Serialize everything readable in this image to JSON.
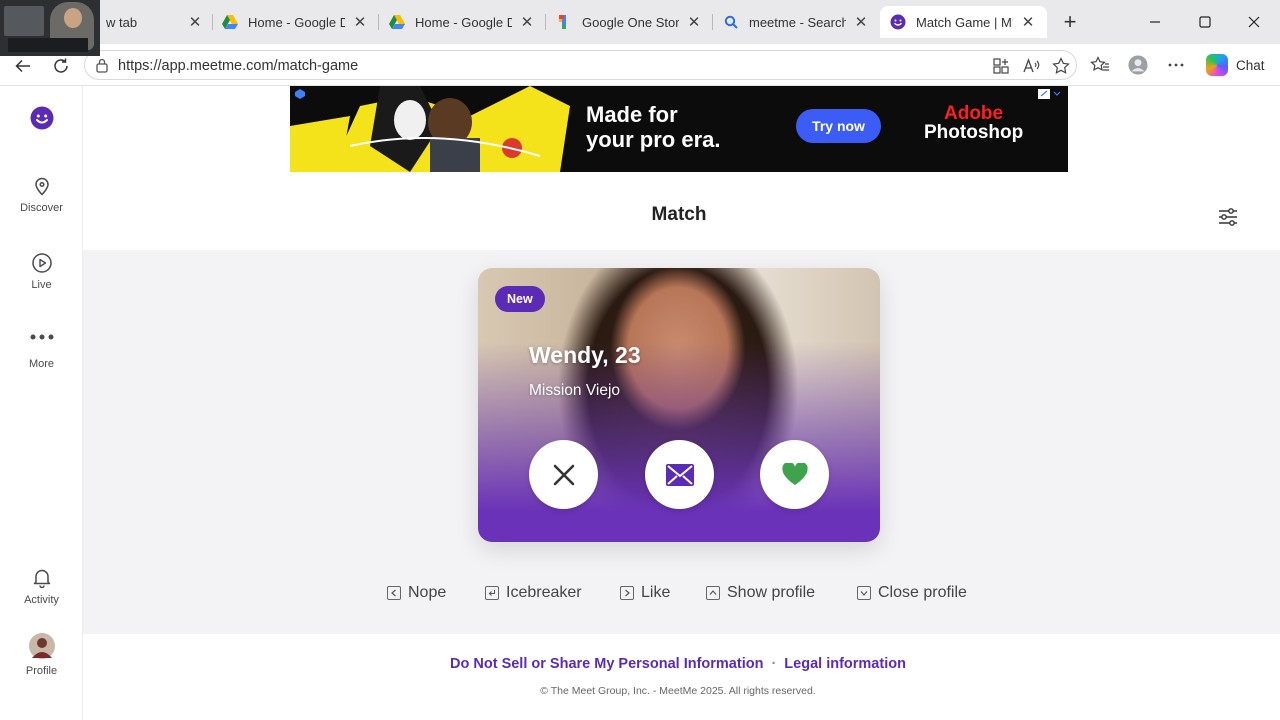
{
  "browser": {
    "tabs": [
      {
        "title": "w tab",
        "icon": "new-tab-icon"
      },
      {
        "title": "Home - Google Dr",
        "icon": "google-drive-icon"
      },
      {
        "title": "Home - Google Dr",
        "icon": "google-drive-icon"
      },
      {
        "title": "Google One Storag",
        "icon": "google-one-icon"
      },
      {
        "title": "meetme - Search",
        "icon": "search-icon"
      },
      {
        "title": "Match Game | ME",
        "icon": "meetme-icon",
        "active": true
      }
    ],
    "url": "https://app.meetme.com/match-game",
    "chat_label": "Chat"
  },
  "sidebar": {
    "items": [
      {
        "label": "Discover",
        "icon": "location-pin-icon"
      },
      {
        "label": "Live",
        "icon": "play-circle-icon"
      },
      {
        "label": "More",
        "icon": "more-dots-icon"
      },
      {
        "label": "Activity",
        "icon": "bell-icon"
      },
      {
        "label": "Profile",
        "icon": "avatar"
      }
    ]
  },
  "ad": {
    "headline_line1": "Made for",
    "headline_line2": "your pro era.",
    "cta": "Try now",
    "brand_line1": "Adobe",
    "brand_line2": "Photoshop"
  },
  "match": {
    "title": "Match",
    "card": {
      "badge": "New",
      "name": "Wendy, 23",
      "location": "Mission Viejo"
    },
    "shortcuts": [
      {
        "label": "Nope"
      },
      {
        "label": "Icebreaker"
      },
      {
        "label": "Like"
      },
      {
        "label": "Show profile"
      },
      {
        "label": "Close profile"
      }
    ]
  },
  "footer": {
    "link1": "Do Not Sell or Share My Personal Information",
    "separator": "·",
    "link2": "Legal information",
    "copyright": "© The Meet Group, Inc. - MeetMe 2025. All rights reserved."
  },
  "colors": {
    "brand": "#5b2bb5",
    "like": "#3fa34d",
    "ad_cta": "#3b5cf5"
  }
}
